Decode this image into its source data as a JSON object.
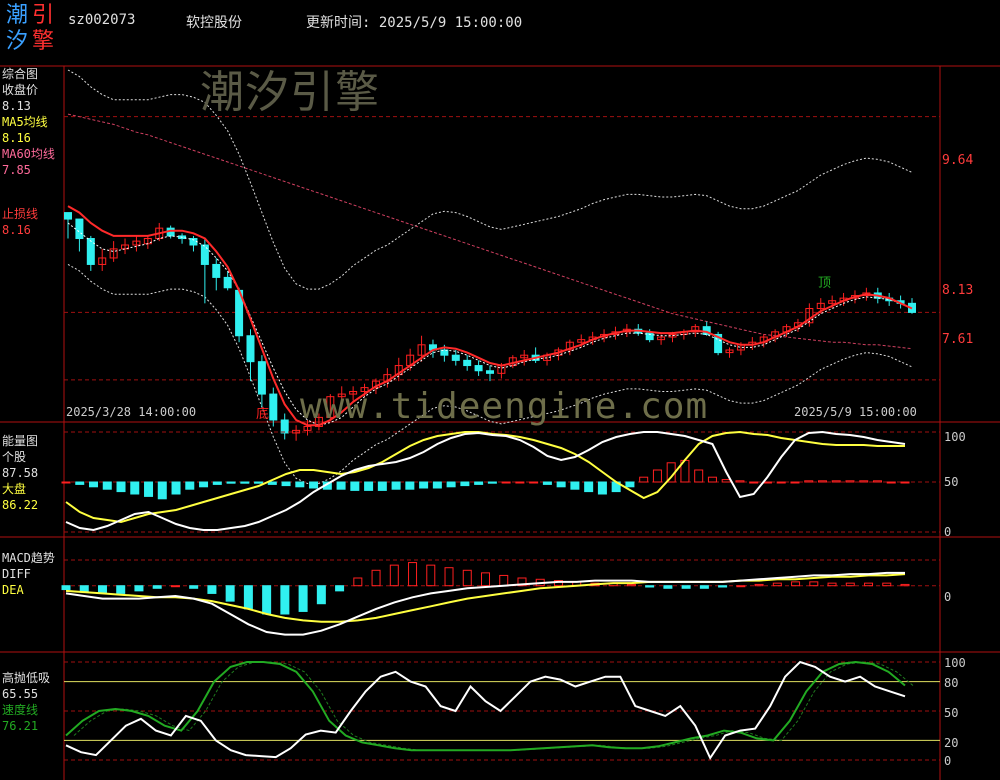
{
  "header": {
    "logo_chars": [
      "潮",
      "引",
      "汐",
      "擎"
    ],
    "code": "sz002073",
    "name": "软控股份",
    "update_label": "更新时间: 2025/5/9 15:00:00"
  },
  "watermark": {
    "cn": "潮汐引擎",
    "url": "www.tideengine.com"
  },
  "panel1": {
    "title": "综合图",
    "close_label": "收盘价",
    "close_value": "8.13",
    "ma5_label": "MA5均线",
    "ma5_value": "8.16",
    "ma60_label": "MA60均线",
    "ma60_value": "7.85",
    "stop_label": "止损线",
    "stop_value": "8.16",
    "ticks": [
      "9.64",
      "8.13",
      "7.61"
    ],
    "date_start": "2025/3/28 14:00:00",
    "date_end": "2025/5/9 15:00:00",
    "top_mark": "顶",
    "bottom_mark": "底"
  },
  "panel2": {
    "title": "能量图",
    "stock_label": "个股",
    "stock_value": "87.58",
    "market_label": "大盘",
    "market_value": "86.22",
    "ticks": [
      "100",
      "50",
      "0"
    ]
  },
  "panel3": {
    "title": "MACD趋势",
    "diff_label": "DIFF",
    "dea_label": "DEA",
    "ticks": [
      "0"
    ]
  },
  "panel4": {
    "title": "高抛低吸",
    "value": "65.55",
    "speed_label": "速度线",
    "speed_value": "76.21",
    "ticks": [
      "100",
      "80",
      "50",
      "20",
      "0"
    ]
  },
  "colors": {
    "up": "#ff2020",
    "down": "#30f0f0",
    "grid": "#a01010",
    "ma5": "#ffffff",
    "ma60": "#ff2a2a",
    "yellow": "#ffff40",
    "green": "#22aa22"
  },
  "chart_data": [
    {
      "type": "candlestick",
      "title": "综合图",
      "x_start": "2025/3/28 14:00:00",
      "x_end": "2025/5/9 15:00:00",
      "ylim": [
        7.3,
        10.0
      ],
      "y_ticks": [
        9.64,
        8.13,
        7.61
      ],
      "ohlc": [
        [
          8.9,
          8.9,
          8.7,
          8.85
        ],
        [
          8.85,
          8.85,
          8.6,
          8.7
        ],
        [
          8.7,
          8.72,
          8.45,
          8.5
        ],
        [
          8.5,
          8.62,
          8.45,
          8.55
        ],
        [
          8.55,
          8.68,
          8.52,
          8.62
        ],
        [
          8.62,
          8.7,
          8.58,
          8.65
        ],
        [
          8.65,
          8.72,
          8.6,
          8.68
        ],
        [
          8.66,
          8.72,
          8.62,
          8.7
        ],
        [
          8.7,
          8.82,
          8.68,
          8.78
        ],
        [
          8.78,
          8.8,
          8.7,
          8.72
        ],
        [
          8.72,
          8.74,
          8.66,
          8.7
        ],
        [
          8.7,
          8.72,
          8.6,
          8.65
        ],
        [
          8.65,
          8.7,
          8.2,
          8.5
        ],
        [
          8.5,
          8.55,
          8.3,
          8.4
        ],
        [
          8.4,
          8.45,
          8.3,
          8.32
        ],
        [
          8.3,
          8.32,
          7.9,
          7.95
        ],
        [
          7.95,
          8.0,
          7.6,
          7.75
        ],
        [
          7.75,
          7.8,
          7.4,
          7.5
        ],
        [
          7.5,
          7.55,
          7.25,
          7.3
        ],
        [
          7.3,
          7.35,
          7.15,
          7.2
        ],
        [
          7.2,
          7.26,
          7.14,
          7.22
        ],
        [
          7.22,
          7.3,
          7.18,
          7.25
        ],
        [
          7.25,
          7.35,
          7.22,
          7.32
        ],
        [
          7.32,
          7.5,
          7.3,
          7.48
        ],
        [
          7.48,
          7.56,
          7.42,
          7.5
        ],
        [
          7.5,
          7.56,
          7.45,
          7.52
        ],
        [
          7.52,
          7.58,
          7.48,
          7.55
        ],
        [
          7.55,
          7.62,
          7.5,
          7.6
        ],
        [
          7.6,
          7.7,
          7.55,
          7.65
        ],
        [
          7.65,
          7.78,
          7.6,
          7.72
        ],
        [
          7.72,
          7.85,
          7.68,
          7.8
        ],
        [
          7.8,
          7.95,
          7.75,
          7.88
        ],
        [
          7.88,
          7.92,
          7.78,
          7.84
        ],
        [
          7.84,
          7.88,
          7.75,
          7.8
        ],
        [
          7.8,
          7.84,
          7.72,
          7.76
        ],
        [
          7.76,
          7.8,
          7.68,
          7.72
        ],
        [
          7.72,
          7.76,
          7.64,
          7.68
        ],
        [
          7.68,
          7.72,
          7.6,
          7.66
        ],
        [
          7.66,
          7.74,
          7.62,
          7.72
        ],
        [
          7.72,
          7.8,
          7.7,
          7.78
        ],
        [
          7.78,
          7.84,
          7.72,
          7.8
        ],
        [
          7.8,
          7.86,
          7.74,
          7.76
        ],
        [
          7.76,
          7.82,
          7.72,
          7.8
        ],
        [
          7.8,
          7.86,
          7.76,
          7.84
        ],
        [
          7.84,
          7.92,
          7.8,
          7.9
        ],
        [
          7.9,
          7.96,
          7.86,
          7.92
        ],
        [
          7.92,
          7.98,
          7.88,
          7.94
        ],
        [
          7.94,
          8.0,
          7.9,
          7.96
        ],
        [
          7.96,
          8.02,
          7.92,
          7.98
        ],
        [
          7.98,
          8.04,
          7.94,
          8.0
        ],
        [
          8.0,
          8.04,
          7.95,
          7.97
        ],
        [
          7.97,
          8.0,
          7.9,
          7.92
        ],
        [
          7.92,
          7.96,
          7.88,
          7.94
        ],
        [
          7.94,
          7.98,
          7.9,
          7.96
        ],
        [
          7.96,
          8.0,
          7.92,
          7.98
        ],
        [
          7.98,
          8.04,
          7.94,
          8.02
        ],
        [
          8.02,
          8.06,
          7.95,
          7.96
        ],
        [
          7.96,
          7.98,
          7.8,
          7.82
        ],
        [
          7.82,
          7.86,
          7.78,
          7.84
        ],
        [
          7.84,
          7.9,
          7.8,
          7.88
        ],
        [
          7.88,
          7.94,
          7.84,
          7.9
        ],
        [
          7.9,
          7.96,
          7.86,
          7.94
        ],
        [
          7.94,
          8.0,
          7.9,
          7.98
        ],
        [
          7.98,
          8.04,
          7.94,
          8.02
        ],
        [
          8.02,
          8.08,
          7.98,
          8.05
        ],
        [
          8.05,
          8.2,
          8.02,
          8.16
        ],
        [
          8.16,
          8.24,
          8.12,
          8.2
        ],
        [
          8.2,
          8.26,
          8.16,
          8.22
        ],
        [
          8.22,
          8.28,
          8.18,
          8.24
        ],
        [
          8.24,
          8.3,
          8.2,
          8.26
        ],
        [
          8.26,
          8.32,
          8.22,
          8.28
        ],
        [
          8.28,
          8.32,
          8.2,
          8.24
        ],
        [
          8.24,
          8.28,
          8.18,
          8.22
        ],
        [
          8.22,
          8.26,
          8.16,
          8.2
        ],
        [
          8.2,
          8.24,
          8.12,
          8.13
        ]
      ],
      "ma5": [
        8.82,
        8.75,
        8.68,
        8.62,
        8.6,
        8.62,
        8.64,
        8.66,
        8.7,
        8.72,
        8.71,
        8.69,
        8.64,
        8.55,
        8.45,
        8.3,
        8.1,
        7.9,
        7.7,
        7.52,
        7.38,
        7.3,
        7.26,
        7.28,
        7.32,
        7.4,
        7.48,
        7.54,
        7.58,
        7.64,
        7.7,
        7.76,
        7.82,
        7.84,
        7.83,
        7.8,
        7.76,
        7.72,
        7.7,
        7.72,
        7.75,
        7.77,
        7.78,
        7.8,
        7.83,
        7.86,
        7.9,
        7.93,
        7.95,
        7.97,
        7.97,
        7.96,
        7.95,
        7.95,
        7.96,
        7.97,
        7.96,
        7.92,
        7.88,
        7.86,
        7.86,
        7.88,
        7.92,
        7.96,
        8.0,
        8.06,
        8.12,
        8.16,
        8.2,
        8.23,
        8.25,
        8.24,
        8.23,
        8.2,
        8.16
      ],
      "ma60": [
        9.66,
        9.64,
        9.62,
        9.6,
        9.58,
        9.55,
        9.52,
        9.5,
        9.47,
        9.44,
        9.41,
        9.38,
        9.35,
        9.32,
        9.29,
        9.26,
        9.23,
        9.2,
        9.17,
        9.14,
        9.11,
        9.08,
        9.05,
        9.02,
        8.99,
        8.96,
        8.93,
        8.9,
        8.87,
        8.84,
        8.81,
        8.78,
        8.75,
        8.72,
        8.69,
        8.66,
        8.63,
        8.6,
        8.57,
        8.54,
        8.51,
        8.48,
        8.45,
        8.42,
        8.39,
        8.36,
        8.33,
        8.3,
        8.27,
        8.24,
        8.21,
        8.18,
        8.15,
        8.12,
        8.1,
        8.08,
        8.06,
        8.04,
        8.02,
        8.0,
        7.98,
        7.96,
        7.95,
        7.94,
        7.93,
        7.92,
        7.91,
        7.9,
        7.9,
        7.89,
        7.88,
        7.88,
        7.87,
        7.86,
        7.85
      ],
      "stop": [
        8.95,
        8.9,
        8.82,
        8.76,
        8.72,
        8.72,
        8.72,
        8.72,
        8.74,
        8.76,
        8.76,
        8.74,
        8.7,
        8.6,
        8.48,
        8.3,
        8.08,
        7.85,
        7.62,
        7.42,
        7.3,
        7.26,
        7.26,
        7.3,
        7.36,
        7.44,
        7.5,
        7.56,
        7.6,
        7.66,
        7.72,
        7.78,
        7.84,
        7.86,
        7.85,
        7.82,
        7.78,
        7.74,
        7.72,
        7.74,
        7.76,
        7.78,
        7.8,
        7.82,
        7.85,
        7.88,
        7.92,
        7.95,
        7.97,
        7.99,
        7.99,
        7.98,
        7.97,
        7.97,
        7.98,
        7.99,
        7.98,
        7.94,
        7.9,
        7.88,
        7.88,
        7.9,
        7.94,
        7.98,
        8.02,
        8.08,
        8.14,
        8.18,
        8.22,
        8.25,
        8.27,
        8.26,
        8.24,
        8.2,
        8.16
      ]
    },
    {
      "type": "line",
      "title": "能量图",
      "ylim": [
        0,
        100
      ],
      "y_ticks": [
        100,
        50,
        0
      ],
      "series": [
        {
          "name": "个股",
          "values": [
            10,
            4,
            2,
            6,
            12,
            18,
            20,
            14,
            8,
            4,
            2,
            2,
            4,
            6,
            10,
            16,
            22,
            30,
            40,
            48,
            56,
            62,
            66,
            68,
            70,
            74,
            80,
            88,
            94,
            98,
            99,
            97,
            96,
            92,
            85,
            76,
            72,
            75,
            82,
            90,
            95,
            98,
            100,
            100,
            98,
            96,
            92,
            88,
            60,
            35,
            38,
            55,
            75,
            92,
            99,
            100,
            98,
            97,
            95,
            92,
            90,
            88
          ]
        },
        {
          "name": "大盘",
          "values": [
            30,
            20,
            14,
            12,
            10,
            14,
            18,
            20,
            22,
            26,
            30,
            34,
            38,
            42,
            46,
            52,
            58,
            62,
            62,
            60,
            58,
            60,
            64,
            70,
            78,
            86,
            92,
            96,
            98,
            100,
            100,
            98,
            97,
            95,
            92,
            88,
            84,
            78,
            70,
            60,
            50,
            42,
            34,
            40,
            55,
            72,
            88,
            96,
            99,
            100,
            98,
            97,
            94,
            92,
            90,
            88,
            87,
            87,
            87,
            86,
            86,
            86
          ]
        }
      ],
      "bars": [
        0,
        -2,
        -4,
        -6,
        -8,
        -10,
        -12,
        -14,
        -10,
        -6,
        -4,
        -2,
        -1,
        -1,
        -1,
        -2,
        -3,
        -4,
        -5,
        -6,
        -6,
        -7,
        -7,
        -7,
        -6,
        -6,
        -5,
        -5,
        -4,
        -3,
        -2,
        -1,
        0,
        0,
        0,
        -2,
        -4,
        -6,
        -8,
        -10,
        -8,
        -4,
        4,
        10,
        16,
        18,
        10,
        4,
        2,
        1,
        0,
        0,
        0,
        0,
        1,
        1,
        1,
        1,
        1,
        1,
        0,
        0
      ]
    },
    {
      "type": "line",
      "title": "MACD趋势",
      "ylim": [
        -0.5,
        0.2
      ],
      "y_ticks": [
        0
      ],
      "series": [
        {
          "name": "DIFF",
          "values": [
            -0.06,
            -0.08,
            -0.1,
            -0.1,
            -0.1,
            -0.09,
            -0.08,
            -0.1,
            -0.14,
            -0.22,
            -0.3,
            -0.36,
            -0.38,
            -0.38,
            -0.35,
            -0.3,
            -0.24,
            -0.18,
            -0.13,
            -0.09,
            -0.06,
            -0.04,
            -0.02,
            -0.01,
            0.0,
            0.01,
            0.02,
            0.03,
            0.03,
            0.04,
            0.04,
            0.04,
            0.03,
            0.03,
            0.03,
            0.03,
            0.03,
            0.04,
            0.05,
            0.06,
            0.07,
            0.08,
            0.08,
            0.09,
            0.09,
            0.1,
            0.1
          ]
        },
        {
          "name": "DEA",
          "values": [
            -0.04,
            -0.05,
            -0.06,
            -0.07,
            -0.08,
            -0.09,
            -0.09,
            -0.1,
            -0.12,
            -0.15,
            -0.18,
            -0.22,
            -0.25,
            -0.27,
            -0.28,
            -0.28,
            -0.27,
            -0.25,
            -0.22,
            -0.19,
            -0.16,
            -0.13,
            -0.1,
            -0.08,
            -0.06,
            -0.04,
            -0.02,
            -0.01,
            0.0,
            0.01,
            0.02,
            0.02,
            0.03,
            0.03,
            0.03,
            0.03,
            0.03,
            0.04,
            0.04,
            0.05,
            0.05,
            0.06,
            0.07,
            0.07,
            0.08,
            0.08,
            0.09
          ]
        },
        {
          "name": "MACD",
          "values": [
            -0.03,
            -0.05,
            -0.06,
            -0.06,
            -0.04,
            -0.02,
            0.0,
            -0.02,
            -0.06,
            -0.12,
            -0.18,
            -0.22,
            -0.22,
            -0.2,
            -0.14,
            -0.04,
            0.06,
            0.12,
            0.16,
            0.18,
            0.16,
            0.14,
            0.12,
            0.1,
            0.08,
            0.06,
            0.05,
            0.04,
            0.03,
            0.02,
            0.02,
            0.01,
            -0.01,
            -0.02,
            -0.02,
            -0.02,
            -0.01,
            0.0,
            0.01,
            0.02,
            0.03,
            0.03,
            0.02,
            0.02,
            0.02,
            0.02,
            0.01
          ]
        }
      ]
    },
    {
      "type": "line",
      "title": "高抛低吸",
      "ylim": [
        0,
        100
      ],
      "y_ticks": [
        100,
        80,
        50,
        20,
        0
      ],
      "series": [
        {
          "name": "高抛低吸",
          "values": [
            15,
            8,
            5,
            20,
            35,
            42,
            30,
            25,
            45,
            40,
            20,
            10,
            5,
            4,
            3,
            12,
            26,
            30,
            28,
            50,
            70,
            85,
            90,
            80,
            75,
            55,
            50,
            75,
            60,
            50,
            65,
            80,
            85,
            82,
            75,
            80,
            85,
            85,
            55,
            50,
            45,
            55,
            35,
            2,
            25,
            30,
            32,
            55,
            85,
            100,
            95,
            85,
            80,
            85,
            75,
            70,
            65
          ]
        },
        {
          "name": "速度线",
          "values": [
            25,
            40,
            50,
            52,
            50,
            45,
            35,
            30,
            50,
            80,
            95,
            100,
            100,
            98,
            90,
            70,
            40,
            25,
            18,
            15,
            12,
            10,
            10,
            10,
            10,
            10,
            10,
            10,
            11,
            12,
            13,
            14,
            15,
            13,
            12,
            12,
            14,
            18,
            22,
            25,
            30,
            28,
            22,
            20,
            40,
            70,
            90,
            98,
            100,
            98,
            90,
            76
          ]
        }
      ]
    }
  ]
}
